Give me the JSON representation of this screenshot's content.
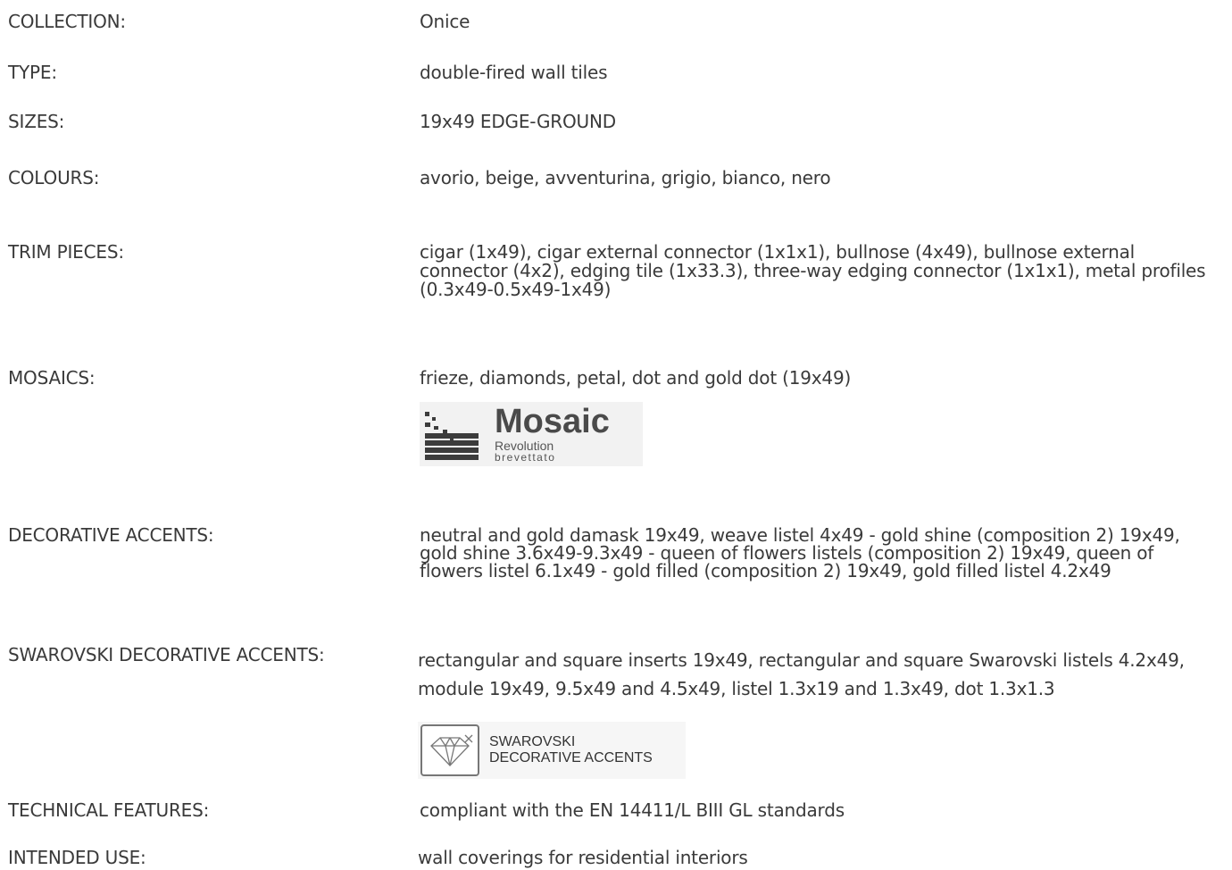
{
  "rows": [
    {
      "label": "COLLECTION:",
      "value": "Onice"
    },
    {
      "label": "TYPE:",
      "value": "double-fired wall tiles"
    },
    {
      "label": "SIZES:",
      "value": "19x49 EDGE-GROUND"
    },
    {
      "label": "COLOURS:",
      "value": "avorio, beige, avventurina, grigio, bianco, nero"
    },
    {
      "label": "TRIM PIECES:",
      "value": "cigar (1x49), cigar external connector (1x1x1), bullnose (4x49), bullnose external connector (4x2), edging tile (1x33.3), three-way edging connector (1x1x1), metal profiles (0.3x49-0.5x49-1x49)"
    },
    {
      "label": "MOSAICS:",
      "value": "frieze, diamonds, petal, dot and gold dot (19x49)"
    },
    {
      "label": "DECORATIVE ACCENTS:",
      "value": "neutral and gold damask 19x49, weave listel 4x49 - gold shine (composition 2) 19x49, gold shine 3.6x49-9.3x49 - queen of flowers listels (composition 2) 19x49, queen of flowers listel 6.1x49 - gold filled (composition 2) 19x49, gold filled listel 4.2x49"
    },
    {
      "label": "SWAROVSKI DECORATIVE ACCENTS:",
      "value": "rectangular and square inserts 19x49, rectangular and square Swarovski listels 4.2x49, module 19x49, 9.5x49 and 4.5x49, listel 1.3x19 and 1.3x49, dot 1.3x1.3"
    },
    {
      "label": "TECHNICAL FEATURES:",
      "value": "compliant with the EN 14411/L BIII GL standards"
    },
    {
      "label": "INTENDED USE:",
      "value": "wall coverings for residential interiors"
    }
  ],
  "logos": {
    "mosaic": {
      "title": "Mosaic",
      "line1": "Revolution",
      "line2": "brevettato"
    },
    "swarovski": {
      "line1": "SWAROVSKI",
      "line2": "DECORATIVE ACCENTS"
    }
  }
}
